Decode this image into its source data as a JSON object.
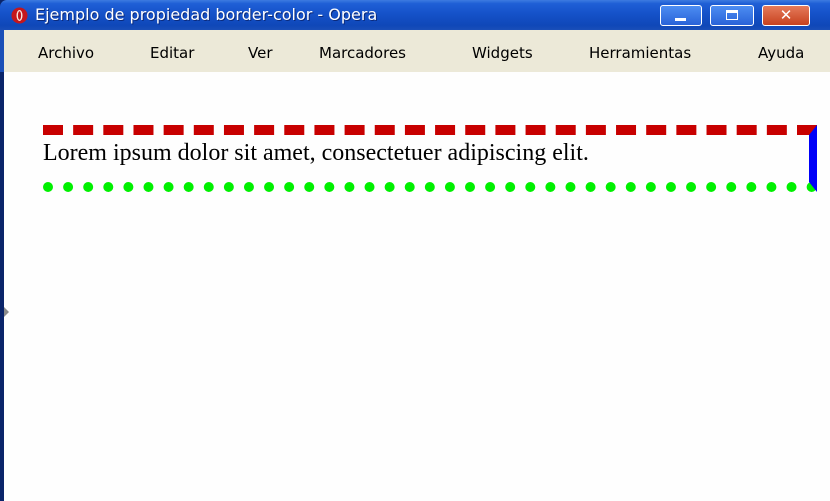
{
  "window": {
    "title": "Ejemplo de propiedad border-color - Opera",
    "app_icon": "opera-icon",
    "controls": {
      "minimize_icon": "minimize-icon",
      "maximize_icon": "maximize-icon",
      "close_glyph": "✕"
    }
  },
  "menubar": {
    "items": [
      {
        "label": "Archivo"
      },
      {
        "label": "Editar"
      },
      {
        "label": "Ver"
      },
      {
        "label": "Marcadores"
      },
      {
        "label": "Widgets"
      },
      {
        "label": "Herramientas"
      },
      {
        "label": "Ayuda"
      }
    ]
  },
  "content": {
    "paragraph_text": "Lorem ipsum dolor sit amet, consectetuer adipiscing elit.",
    "border_colors": {
      "top": "#c80000",
      "right": "#0000f8",
      "bottom": "#00f000"
    },
    "border_styles": {
      "top": "dashed",
      "right": "solid",
      "bottom": "dotted"
    }
  }
}
